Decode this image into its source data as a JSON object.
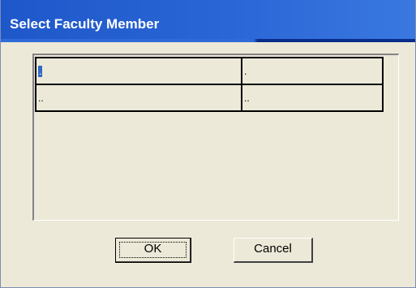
{
  "window": {
    "title": "Select Faculty Member"
  },
  "grid": {
    "rows": [
      {
        "cells": [
          ".",
          "."
        ]
      },
      {
        "cells": [
          "..",
          ".."
        ]
      }
    ],
    "focused_cell": {
      "row": 0,
      "col": 0
    }
  },
  "buttons": {
    "ok_label": "OK",
    "cancel_label": "Cancel"
  },
  "colors": {
    "titlebar": "#2a66d6",
    "dialog_face": "#ece9d8",
    "selection": "#316ac5"
  }
}
